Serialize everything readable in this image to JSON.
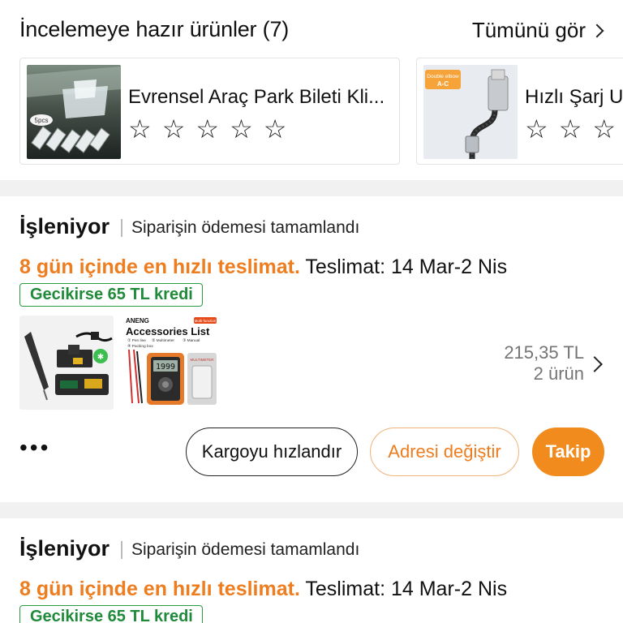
{
  "review": {
    "title": "İncelemeye hazır ürünler (7)",
    "see_all": "Tümünü gör",
    "products": [
      {
        "name": "Evrensel Araç Park Bileti Kli...",
        "badge": "5pcs",
        "rating_stars": 5
      },
      {
        "name": "Hızlı Şarj U",
        "badge_line1": "Double elbow",
        "badge_line2": "A-C",
        "rating_stars": 3
      }
    ]
  },
  "orders": [
    {
      "status": "İşleniyor",
      "payment": "Siparişin ödemesi tamamlandı",
      "delivery_fast": "8 gün içinde en hızlı teslimat.",
      "delivery_date": " Teslimat: 14 Mar-2 Nis",
      "credit": "Gecikirse 65 TL kredi",
      "price": "215,35 TL",
      "count": "2 ürün",
      "more": "•••",
      "buttons": {
        "speed": "Kargoyu hızlandır",
        "address": "Adresi değiştir",
        "track": "Takip"
      },
      "accessory_image": {
        "brand": "ANENG",
        "tag": "Multi-function",
        "title": "Accessories List",
        "items": [
          "① Pen line",
          "② Multimeter",
          "③ Manual",
          "④ Packing box"
        ],
        "screen": "1999",
        "meter_label": "MULTIMETER"
      }
    },
    {
      "status": "İşleniyor",
      "payment": "Siparişin ödemesi tamamlandı",
      "delivery_fast": "8 gün içinde en hızlı teslimat.",
      "delivery_date": " Teslimat: 14 Mar-2 Nis",
      "credit": "Gecikirse 65 TL kredi"
    }
  ],
  "colors": {
    "accent": "#ee7d1f",
    "track_button": "#f28b1e",
    "credit_green": "#1f8a3a",
    "divider": "#f1f1f1"
  }
}
